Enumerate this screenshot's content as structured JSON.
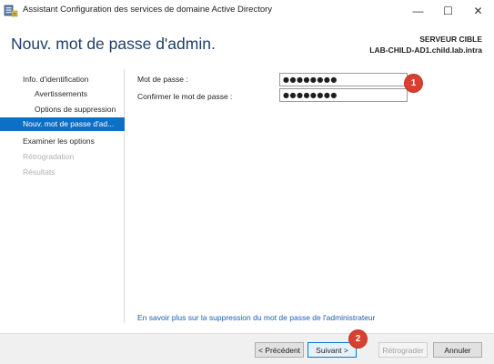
{
  "window": {
    "title": "Assistant Configuration des services de domaine Active Directory",
    "minimize_glyph": "—",
    "maximize_glyph": "☐",
    "close_glyph": "✕"
  },
  "header": {
    "title": "Nouv. mot de passe d'admin.",
    "server_label": "SERVEUR CIBLE",
    "server_name": "LAB-CHILD-AD1.child.lab.intra"
  },
  "sidebar": {
    "items": [
      {
        "label": "Info. d'identification",
        "state": "normal"
      },
      {
        "label": "Avertissements",
        "state": "sub"
      },
      {
        "label": "Options de suppression",
        "state": "sub"
      },
      {
        "label": "Nouv. mot de passe d'ad...",
        "state": "active"
      },
      {
        "label": "Examiner les options",
        "state": "normal"
      },
      {
        "label": "Rétrogradation",
        "state": "disabled"
      },
      {
        "label": "Résultats",
        "state": "disabled"
      }
    ]
  },
  "form": {
    "password_label": "Mot de passe :",
    "password_value": "●●●●●●●●",
    "confirm_label": "Confirmer le mot de passe :",
    "confirm_value": "●●●●●●●●"
  },
  "markers": {
    "one": "1",
    "two": "2"
  },
  "help_link": "En savoir plus sur la suppression du mot de passe de l'administrateur",
  "footer": {
    "previous": "< Précédent",
    "next": "Suivant >",
    "demote": "Rétrograder",
    "cancel": "Annuler"
  },
  "colors": {
    "accent": "#0e6fc7",
    "title": "#1e3f68",
    "link": "#1f5fb0",
    "marker": "#d8402f"
  }
}
